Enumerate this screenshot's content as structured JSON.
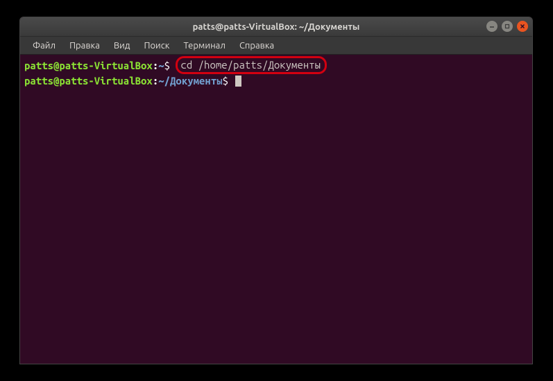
{
  "titlebar": {
    "title": "patts@patts-VirtualBox: ~/Документы"
  },
  "menubar": {
    "items": [
      "Файл",
      "Правка",
      "Вид",
      "Поиск",
      "Терминал",
      "Справка"
    ]
  },
  "terminal": {
    "line1": {
      "user": "patts@patts-VirtualBox",
      "colon": ":",
      "path": "~",
      "dollar": "$ ",
      "command": "cd /home/patts/Документы"
    },
    "line2": {
      "user": "patts@patts-VirtualBox",
      "colon": ":",
      "path": "~/Документы",
      "dollar": "$ "
    }
  }
}
